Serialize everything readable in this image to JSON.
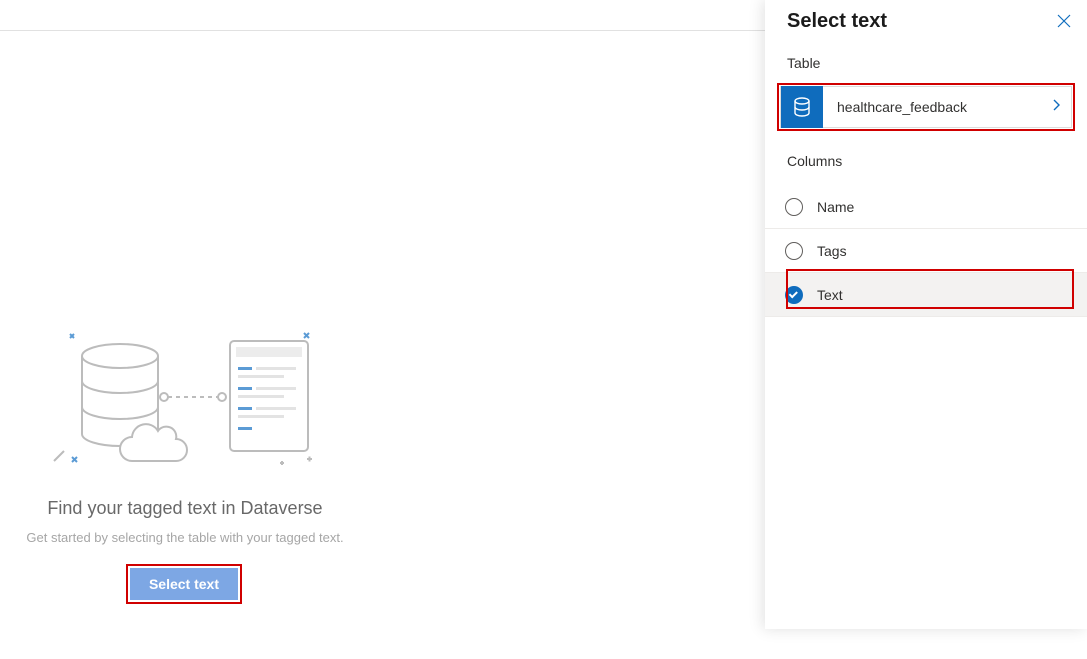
{
  "main": {
    "heading": "Find your tagged text in Dataverse",
    "subtext": "Get started by selecting the table with your tagged text.",
    "select_button": "Select text"
  },
  "panel": {
    "title": "Select text",
    "table_label": "Table",
    "table_name": "healthcare_feedback",
    "columns_label": "Columns",
    "columns": [
      {
        "label": "Name",
        "selected": false
      },
      {
        "label": "Tags",
        "selected": false
      },
      {
        "label": "Text",
        "selected": true
      }
    ]
  }
}
